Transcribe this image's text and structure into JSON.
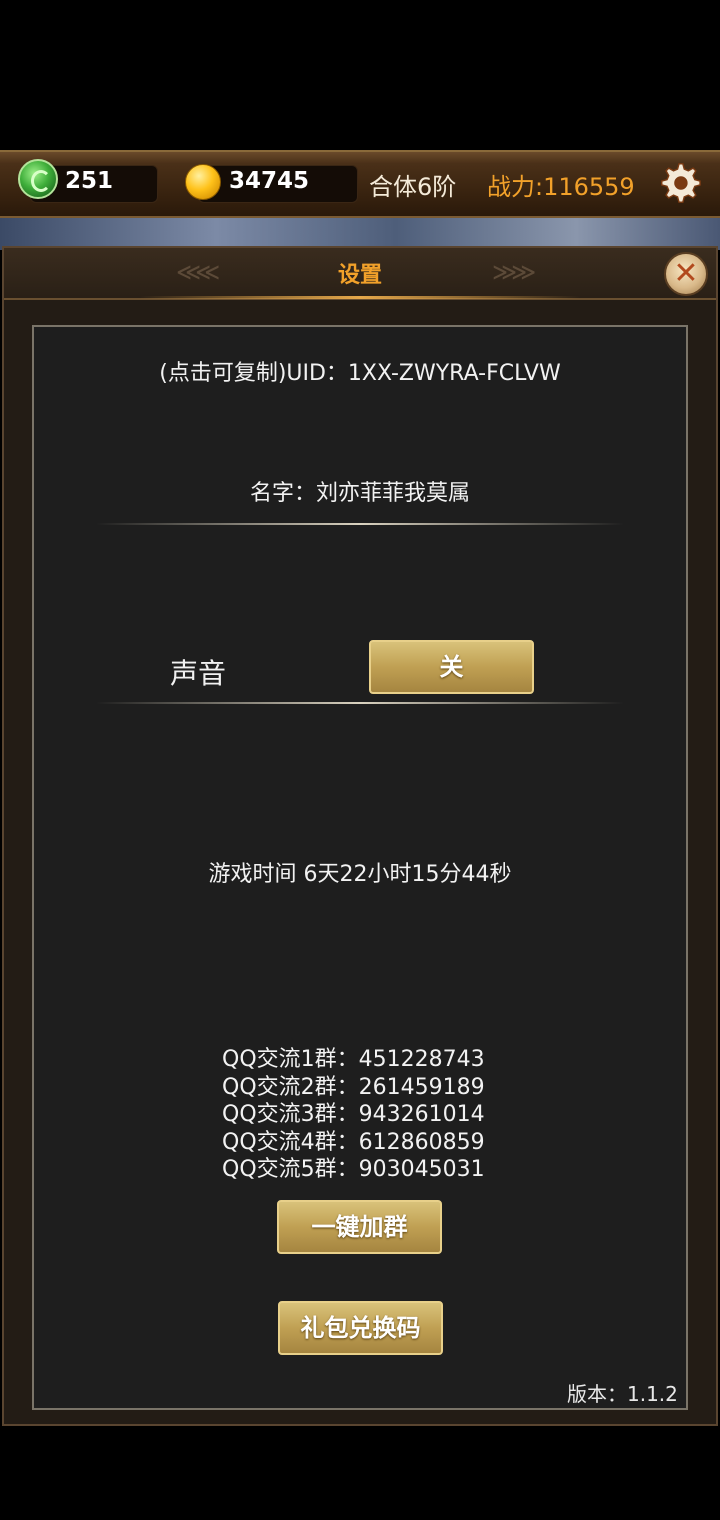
{
  "topbar": {
    "jade_value": "251",
    "gold_value": "34745",
    "stage": "合体6阶",
    "power": "战力:116559"
  },
  "panel": {
    "title": "设置",
    "uid": "(点击可复制)UID：1XX-ZWYRA-FCLVW",
    "name": "名字：刘亦菲菲我莫属",
    "sound_label": "声音",
    "sound_button": "关",
    "play_time": "游戏时间 6天22小时15分44秒",
    "qq_groups": [
      "QQ交流1群：451228743",
      "QQ交流2群：261459189",
      "QQ交流3群：943261014",
      "QQ交流4群：612860859",
      "QQ交流5群：903045031"
    ],
    "join_button": "一键加群",
    "gift_button": "礼包兑换码",
    "version": "版本：1.1.2"
  },
  "icons": {
    "jade": "jade-icon",
    "gold": "gold-coin-icon",
    "settings": "gear-icon",
    "close": "close-icon"
  },
  "colors": {
    "accent_gold": "#f2a12a",
    "button_gold": "#c0a053",
    "panel_bg": "#231c15",
    "inner_bg": "#1e1e1e"
  }
}
